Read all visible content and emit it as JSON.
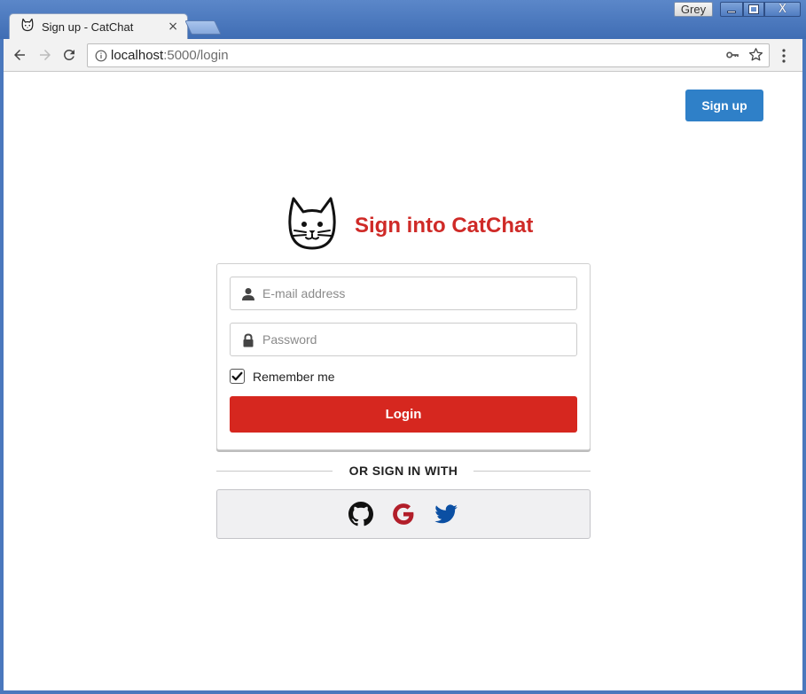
{
  "browser": {
    "user_label": "Grey",
    "tab": {
      "title": "Sign up - CatChat",
      "close_glyph": "×",
      "icon": "cat-favicon-icon"
    },
    "url": {
      "host": "localhost",
      "path": ":5000/login"
    },
    "window_controls": [
      "minimize",
      "maximize",
      "close"
    ],
    "close_glyph": "X"
  },
  "header": {
    "signup_label": "Sign up"
  },
  "login": {
    "title": "Sign into CatChat",
    "email_placeholder": "E-mail address",
    "password_placeholder": "Password",
    "remember_label": "Remember me",
    "remember_checked": true,
    "submit_label": "Login"
  },
  "social": {
    "divider_text": "OR SIGN IN WITH",
    "providers": [
      {
        "name": "github",
        "icon": "github-icon",
        "color": "#111111"
      },
      {
        "name": "google",
        "icon": "google-icon",
        "color": "#b21e2a"
      },
      {
        "name": "twitter",
        "icon": "twitter-icon",
        "color": "#0b4fa3"
      }
    ]
  },
  "colors": {
    "accent_red": "#cf2a27",
    "login_button": "#d6271f",
    "signup_button": "#2f80c8",
    "titlebar": "#4a78bd"
  }
}
